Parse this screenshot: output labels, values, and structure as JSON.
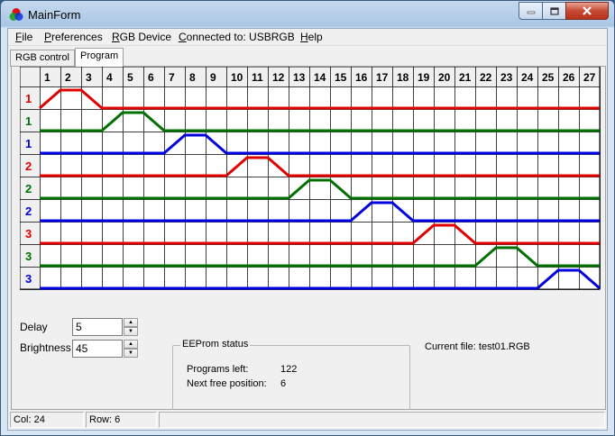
{
  "window": {
    "title": "MainForm"
  },
  "menu": {
    "items": [
      {
        "prefix": "",
        "accel": "F",
        "rest": "ile"
      },
      {
        "prefix": "",
        "accel": "P",
        "rest": "references"
      },
      {
        "prefix": "",
        "accel": "R",
        "rest": "GB Device"
      },
      {
        "prefix": "",
        "accel": "C",
        "rest": "onnected to: USBRGB"
      },
      {
        "prefix": "",
        "accel": "H",
        "rest": "elp"
      }
    ]
  },
  "tabs": [
    {
      "label": "RGB control",
      "active": false
    },
    {
      "label": "Program",
      "active": true
    }
  ],
  "program_grid": {
    "columns": [
      "1",
      "2",
      "3",
      "4",
      "5",
      "6",
      "7",
      "8",
      "9",
      "10",
      "11",
      "12",
      "13",
      "14",
      "15",
      "16",
      "17",
      "18",
      "19",
      "20",
      "21",
      "22",
      "23",
      "24",
      "25",
      "26",
      "27"
    ],
    "rows": [
      {
        "label": "1",
        "color": "#e00000",
        "high_cols": [
          2
        ]
      },
      {
        "label": "1",
        "color": "#007000",
        "high_cols": [
          5
        ]
      },
      {
        "label": "1",
        "color": "#0000e0",
        "high_cols": [
          8
        ]
      },
      {
        "label": "2",
        "color": "#e00000",
        "high_cols": [
          11
        ]
      },
      {
        "label": "2",
        "color": "#007000",
        "high_cols": [
          14
        ]
      },
      {
        "label": "2",
        "color": "#0000e0",
        "high_cols": [
          17
        ]
      },
      {
        "label": "3",
        "color": "#e00000",
        "high_cols": [
          20
        ]
      },
      {
        "label": "3",
        "color": "#007000",
        "high_cols": [
          23
        ]
      },
      {
        "label": "3",
        "color": "#0000e0",
        "high_cols": [
          26
        ]
      }
    ]
  },
  "controls": {
    "delay_label": "Delay",
    "delay_value": "5",
    "brightness_label": "Brightness",
    "brightness_value": "45"
  },
  "eeprom": {
    "title": "EEProm status",
    "programs_left_label": "Programs left:",
    "programs_left_value": "122",
    "next_free_label": "Next free position:",
    "next_free_value": "6"
  },
  "current_file": "Current file: test01.RGB",
  "status": {
    "col": "Col: 24",
    "row": "Row: 6",
    "extra": ""
  }
}
